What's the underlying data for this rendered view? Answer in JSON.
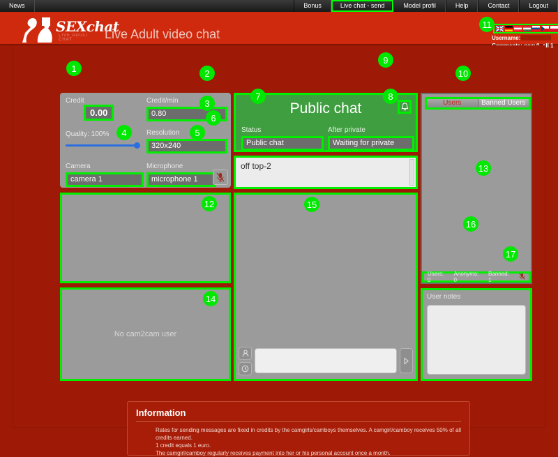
{
  "nav": {
    "left": [
      {
        "label": "News",
        "active": false
      }
    ],
    "right": [
      {
        "label": "Bonus",
        "active": false
      },
      {
        "label": "Live chat - send",
        "active": true
      },
      {
        "label": "Model profil",
        "active": false
      },
      {
        "label": "Help",
        "active": false
      },
      {
        "label": "Contact",
        "active": false
      },
      {
        "label": "Logout",
        "active": false
      }
    ]
  },
  "header": {
    "logo_text": "SEXchat",
    "logo_sub": "LIVE ADULT CHAT",
    "tagline": "Live Adult video chat",
    "username_label": "Username:",
    "comments": "Comments: new 0, all 1",
    "flags": [
      "uk-flag",
      "germany-flag",
      "austria-flag",
      "hungary-flag",
      "slovakia-flag",
      "czech-flag",
      "poland-flag"
    ]
  },
  "settings": {
    "credit_label": "Credit",
    "credit_value": "0.00",
    "creditmin_label": "Credit/min",
    "creditmin_value": "0.80",
    "quality_label": "Quality: 100%",
    "quality_percent": 100,
    "resolution_label": "Resolution",
    "resolution_value": "320x240",
    "camera_label": "Camera",
    "camera_value": "camera 1",
    "microphone_label": "Microphone",
    "microphone_value": "microphone 1",
    "mic_icon": "microphone-muted-icon"
  },
  "video": {
    "self_placeholder": "",
    "c2c_placeholder": "No cam2cam user"
  },
  "chat": {
    "title": "Public chat",
    "bell_icon": "bell-icon",
    "status_label": "Status",
    "status_value": "Public chat",
    "after_private_label": "After private",
    "after_private_value": "Waiting for private",
    "message_text": "off top-2",
    "input_value": "",
    "input_placeholder": "",
    "user_icon": "person-icon",
    "history_icon": "clock-icon",
    "send_icon": "send-arrow-icon"
  },
  "users": {
    "tabs": [
      {
        "label": "Users",
        "active": true
      },
      {
        "label": "Banned Users",
        "active": false
      }
    ],
    "status": {
      "users": "Users: 0",
      "anonyms": "Anonyms: 0",
      "banned": "Banned: 1",
      "icon": "mute-all-icon"
    }
  },
  "notes": {
    "title": "User notes",
    "value": ""
  },
  "information": {
    "title": "Information",
    "lines": [
      "Rates for sending messages are fixed in credits by the camgirls/camboys themselves. A camgirl/camboy receives 50% of all credits earned.",
      "1 credit equals 1 euro.",
      "The camgirl/camboy regularly receives payment into her or his personal account once a month."
    ]
  },
  "badges": {
    "b1": "1",
    "b2": "2",
    "b3": "3",
    "b4": "4",
    "b5": "5",
    "b6": "6",
    "b7": "7",
    "b8": "8",
    "b9": "9",
    "b10": "10",
    "b11": "11",
    "b12": "12",
    "b13": "13",
    "b14": "14",
    "b15": "15",
    "b16": "16",
    "b17": "17"
  },
  "colors": {
    "brand_red": "#cf2a0e",
    "page_red": "#9e1a06",
    "highlight_green": "#00ee00",
    "chat_green": "#3f9e40",
    "slider_blue": "#2a6fe0"
  }
}
